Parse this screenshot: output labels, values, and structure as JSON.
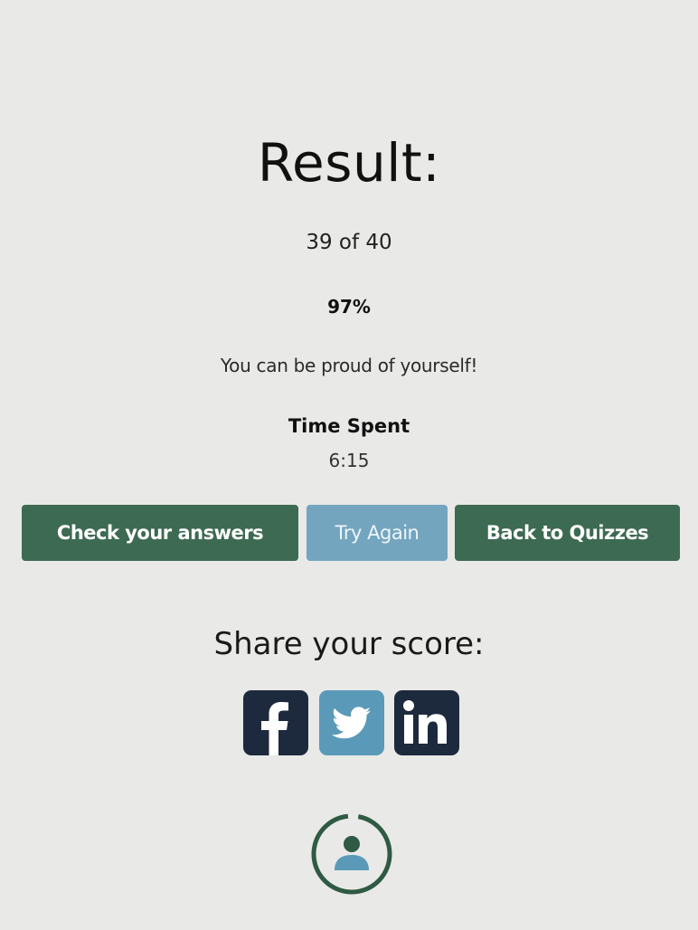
{
  "result": {
    "title": "Result:",
    "score": "39 of 40",
    "percent": "97%",
    "message": "You can be proud of yourself!",
    "time_label": "Time Spent",
    "time_value": "6:15"
  },
  "actions": {
    "check_label": "Check your answers",
    "try_label": "Try Again",
    "back_label": "Back to Quizzes"
  },
  "share": {
    "title": "Share your score:",
    "icons": [
      "facebook-icon",
      "twitter-icon",
      "linkedin-icon"
    ]
  },
  "colors": {
    "background": "#e9e9e7",
    "primary_green": "#3d6a52",
    "secondary_blue": "#73a5bf",
    "social_dark": "#1d2a3e"
  }
}
